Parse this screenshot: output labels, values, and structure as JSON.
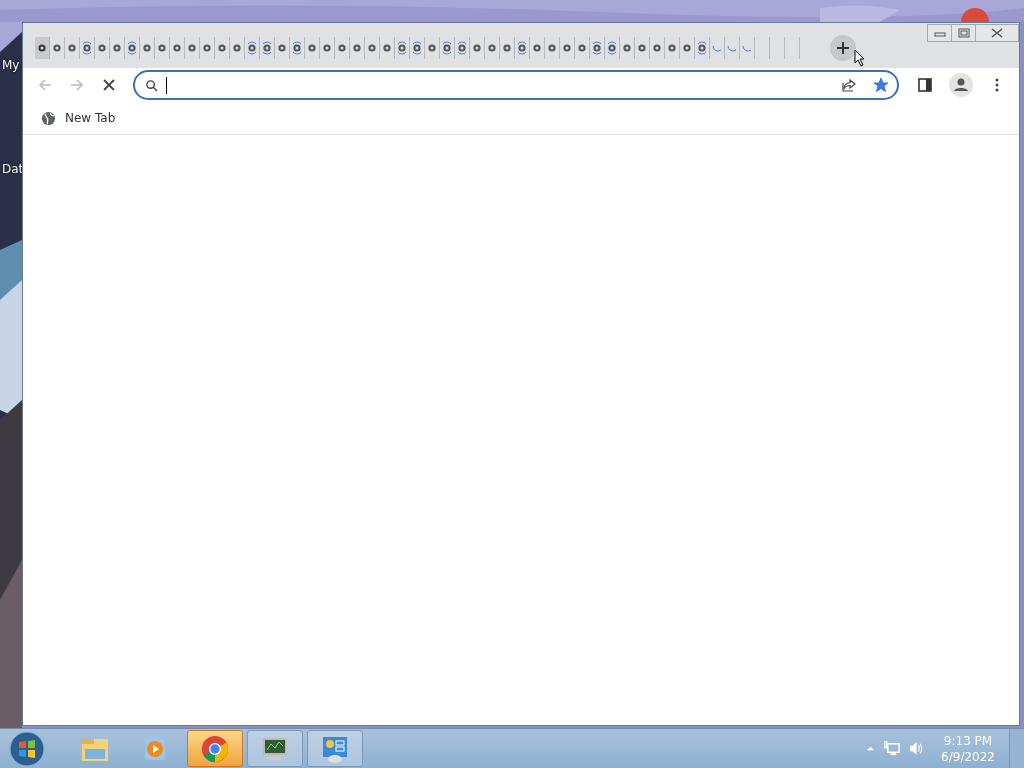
{
  "desktop": {
    "icons": [
      {
        "label": "My"
      },
      {
        "label": "Dat"
      }
    ]
  },
  "browser": {
    "tabs": [
      {
        "kind": "page",
        "selected": true,
        "loading": false
      },
      {
        "kind": "page",
        "selected": false,
        "loading": false
      },
      {
        "kind": "page",
        "selected": false,
        "loading": false
      },
      {
        "kind": "page",
        "selected": false,
        "loading": true
      },
      {
        "kind": "page",
        "selected": false,
        "loading": false
      },
      {
        "kind": "page",
        "selected": false,
        "loading": false
      },
      {
        "kind": "page",
        "selected": false,
        "loading": true
      },
      {
        "kind": "page",
        "selected": false,
        "loading": false
      },
      {
        "kind": "page",
        "selected": false,
        "loading": false
      },
      {
        "kind": "page",
        "selected": false,
        "loading": false
      },
      {
        "kind": "page",
        "selected": false,
        "loading": false
      },
      {
        "kind": "page",
        "selected": false,
        "loading": false
      },
      {
        "kind": "page",
        "selected": false,
        "loading": false
      },
      {
        "kind": "page",
        "selected": false,
        "loading": false
      },
      {
        "kind": "page",
        "selected": false,
        "loading": true
      },
      {
        "kind": "page",
        "selected": false,
        "loading": true
      },
      {
        "kind": "page",
        "selected": false,
        "loading": false
      },
      {
        "kind": "page",
        "selected": false,
        "loading": true
      },
      {
        "kind": "page",
        "selected": false,
        "loading": false
      },
      {
        "kind": "page",
        "selected": false,
        "loading": false
      },
      {
        "kind": "page",
        "selected": false,
        "loading": false
      },
      {
        "kind": "page",
        "selected": false,
        "loading": false
      },
      {
        "kind": "page",
        "selected": false,
        "loading": false
      },
      {
        "kind": "page",
        "selected": false,
        "loading": false
      },
      {
        "kind": "page",
        "selected": false,
        "loading": true
      },
      {
        "kind": "page",
        "selected": false,
        "loading": true
      },
      {
        "kind": "page",
        "selected": false,
        "loading": false
      },
      {
        "kind": "page",
        "selected": false,
        "loading": true
      },
      {
        "kind": "page",
        "selected": false,
        "loading": true
      },
      {
        "kind": "page",
        "selected": false,
        "loading": false
      },
      {
        "kind": "page",
        "selected": false,
        "loading": false
      },
      {
        "kind": "page",
        "selected": false,
        "loading": false
      },
      {
        "kind": "page",
        "selected": false,
        "loading": true
      },
      {
        "kind": "page",
        "selected": false,
        "loading": false
      },
      {
        "kind": "page",
        "selected": false,
        "loading": false
      },
      {
        "kind": "page",
        "selected": false,
        "loading": false
      },
      {
        "kind": "page",
        "selected": false,
        "loading": false
      },
      {
        "kind": "page",
        "selected": false,
        "loading": true
      },
      {
        "kind": "page",
        "selected": false,
        "loading": true
      },
      {
        "kind": "page",
        "selected": false,
        "loading": false
      },
      {
        "kind": "page",
        "selected": false,
        "loading": false
      },
      {
        "kind": "page",
        "selected": false,
        "loading": false
      },
      {
        "kind": "page",
        "selected": false,
        "loading": false
      },
      {
        "kind": "page",
        "selected": false,
        "loading": false
      },
      {
        "kind": "page",
        "selected": false,
        "loading": true
      },
      {
        "kind": "spinner",
        "selected": false
      },
      {
        "kind": "spinner",
        "selected": false
      },
      {
        "kind": "spinner",
        "selected": false
      },
      {
        "kind": "blank",
        "selected": false
      },
      {
        "kind": "blank",
        "selected": false
      },
      {
        "kind": "blank",
        "selected": false
      }
    ],
    "toolbar": {
      "back_disabled": true,
      "forward_disabled": true,
      "loading": true,
      "bookmarked": true
    },
    "bookmarks": [
      {
        "label": "New Tab"
      }
    ]
  },
  "taskbar": {
    "apps": [
      {
        "kind": "explorer",
        "active": false
      },
      {
        "kind": "media",
        "active": false
      },
      {
        "kind": "chrome",
        "active": true
      },
      {
        "kind": "monitor",
        "active": false
      },
      {
        "kind": "control",
        "active": false
      }
    ],
    "time": "9:13 PM",
    "date": "6/9/2022"
  }
}
